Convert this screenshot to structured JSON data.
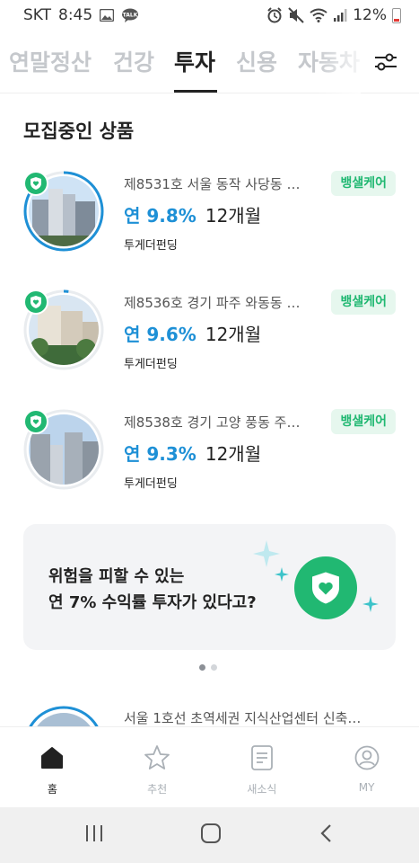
{
  "status_bar": {
    "carrier": "SKT",
    "time": "8:45",
    "battery": "12%"
  },
  "tabs": [
    {
      "label": "연말정산",
      "active": false
    },
    {
      "label": "건강",
      "active": false
    },
    {
      "label": "투자",
      "active": true
    },
    {
      "label": "신용",
      "active": false
    },
    {
      "label": "자동차",
      "active": false
    }
  ],
  "section_title": "모집중인 상품",
  "products": [
    {
      "title": "제8531호 서울 동작 사당동 …",
      "badge": "뱅샐케어",
      "rate": "연 9.8%",
      "term": "12개월",
      "provider": "투게더펀딩",
      "funded_fraction": 0.9
    },
    {
      "title": "제8536호 경기 파주 와동동 …",
      "badge": "뱅샐케어",
      "rate": "연 9.6%",
      "term": "12개월",
      "provider": "투게더펀딩",
      "funded_fraction": 0.02
    },
    {
      "title": "제8538호 경기 고양 풍동 주…",
      "badge": "뱅샐케어",
      "rate": "연 9.3%",
      "term": "12개월",
      "provider": "투게더펀딩",
      "funded_fraction": 0.0
    }
  ],
  "banner": {
    "line1": "위험을 피할 수 있는",
    "line2": "연 7% 수익률 투자가 있다고?"
  },
  "pager": {
    "count": 2,
    "active": 0
  },
  "partial_product": {
    "title": "서울 1호선 초역세권 지식산업센터 신축…"
  },
  "bottom_nav": [
    {
      "label": "홈",
      "icon": "home-icon",
      "active": true
    },
    {
      "label": "추천",
      "icon": "star-icon",
      "active": false
    },
    {
      "label": "새소식",
      "icon": "news-icon",
      "active": false
    },
    {
      "label": "MY",
      "icon": "profile-icon",
      "active": false
    }
  ],
  "colors": {
    "accent_green": "#21b872",
    "rate_blue": "#1e90d6",
    "inactive_tab": "#c5c8cc"
  }
}
